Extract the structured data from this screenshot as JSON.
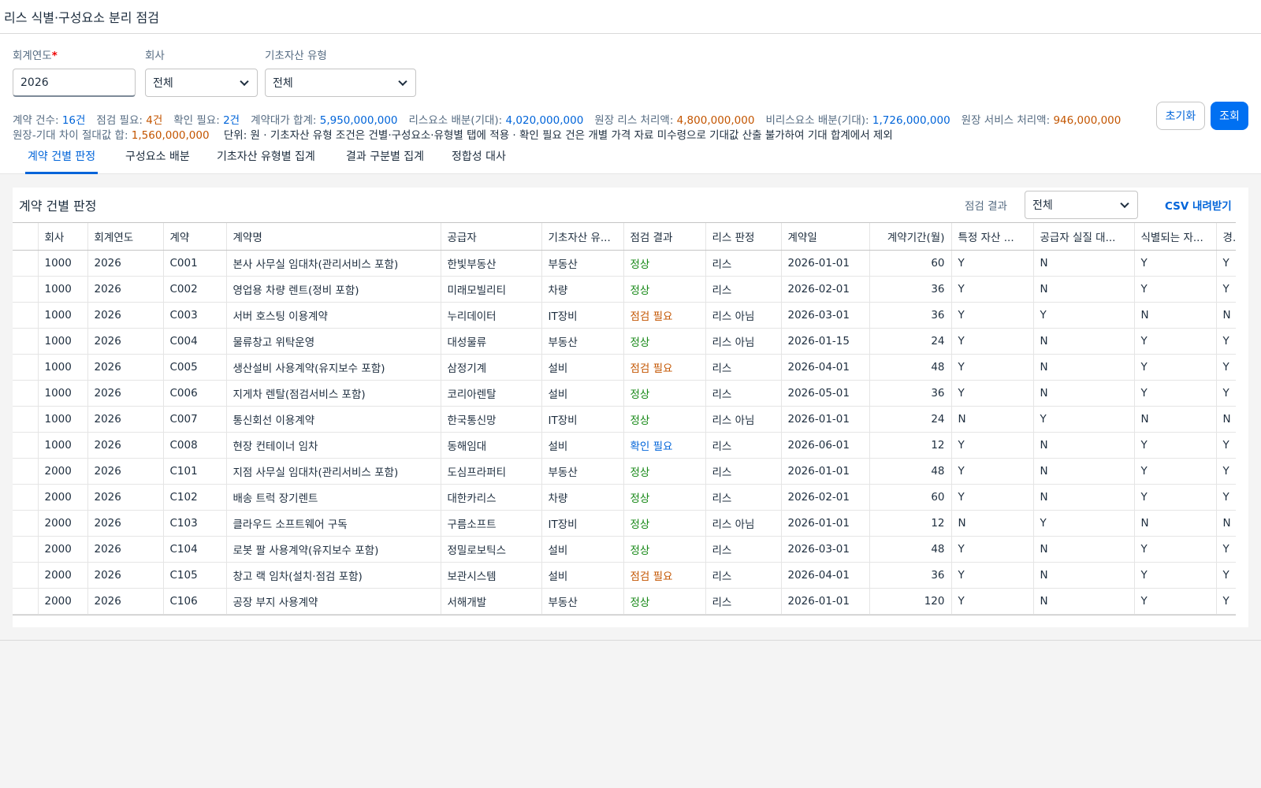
{
  "window": {
    "title": "리스 식별·구성요소 분리 점검"
  },
  "filters": {
    "year": {
      "label": "회계연도",
      "required_mark": "*",
      "value": "2026"
    },
    "company": {
      "label": "회사",
      "value": "전체"
    },
    "asset_type": {
      "label": "기초자산 유형",
      "value": "전체"
    }
  },
  "buttons": {
    "reset": "초기화",
    "search": "조회"
  },
  "summary": {
    "line1": [
      {
        "label": "계약 건수: ",
        "value": "16건",
        "tone": "blue"
      },
      {
        "label": "점검 필요: ",
        "value": "4건",
        "tone": "orange"
      },
      {
        "label": "확인 필요: ",
        "value": "2건",
        "tone": "blue"
      },
      {
        "label": "계약대가 합계: ",
        "value": "5,950,000,000",
        "tone": "blue"
      },
      {
        "label": "리스요소 배분(기대): ",
        "value": "4,020,000,000",
        "tone": "blue"
      },
      {
        "label": "원장 리스 처리액: ",
        "value": "4,800,000,000",
        "tone": "orange"
      },
      {
        "label": "비리스요소 배분(기대): ",
        "value": "1,726,000,000",
        "tone": "blue"
      },
      {
        "label": "원장 서비스 처리액: ",
        "value": "946,000,000",
        "tone": "orange"
      }
    ],
    "line2_label": "원장-기대 차이 절대값 합: ",
    "line2_value": "1,560,000,000",
    "note": "단위: 원 · 기초자산 유형 조건은 건별·구성요소·유형별 탭에 적용 · 확인 필요 건은 개별 가격 자료 미수령으로 기대값 산출 불가하여 기대 합계에서 제외"
  },
  "tabs": [
    {
      "label": "계약 건별 판정",
      "active": true
    },
    {
      "label": "구성요소 배분",
      "active": false
    },
    {
      "label": "기초자산 유형별 집계",
      "active": false
    },
    {
      "label": "결과 구분별 집계",
      "active": false
    },
    {
      "label": "정합성 대사",
      "active": false
    }
  ],
  "panel": {
    "title": "계약 건별 판정",
    "result_filter_label": "점검 결과",
    "result_filter_value": "전체",
    "csv_label": "CSV 내려받기"
  },
  "table": {
    "columns": [
      "회사",
      "회계연도",
      "계약",
      "계약명",
      "공급자",
      "기초자산 유...",
      "점검 결과",
      "리스 판정",
      "계약일",
      "계약기간(월)",
      "특정 자산 ...",
      "공급자 실질 대...",
      "식별되는 자...",
      "경"
    ],
    "rows": [
      [
        "1000",
        "2026",
        "C001",
        "본사 사무실 임대차(관리서비스 포함)",
        "한빛부동산",
        "부동산",
        "정상",
        "리스",
        "2026-01-01",
        "60",
        "Y",
        "N",
        "Y",
        "Y"
      ],
      [
        "1000",
        "2026",
        "C002",
        "영업용 차량 렌트(정비 포함)",
        "미래모빌리티",
        "차량",
        "정상",
        "리스",
        "2026-02-01",
        "36",
        "Y",
        "N",
        "Y",
        "Y"
      ],
      [
        "1000",
        "2026",
        "C003",
        "서버 호스팅 이용계약",
        "누리데이터",
        "IT장비",
        "점검 필요",
        "리스 아님",
        "2026-03-01",
        "36",
        "Y",
        "Y",
        "N",
        "N"
      ],
      [
        "1000",
        "2026",
        "C004",
        "물류창고 위탁운영",
        "대성물류",
        "부동산",
        "정상",
        "리스 아님",
        "2026-01-15",
        "24",
        "Y",
        "N",
        "Y",
        "Y"
      ],
      [
        "1000",
        "2026",
        "C005",
        "생산설비 사용계약(유지보수 포함)",
        "삼정기계",
        "설비",
        "점검 필요",
        "리스",
        "2026-04-01",
        "48",
        "Y",
        "N",
        "Y",
        "Y"
      ],
      [
        "1000",
        "2026",
        "C006",
        "지게차 렌탈(점검서비스 포함)",
        "코리아렌탈",
        "설비",
        "정상",
        "리스",
        "2026-05-01",
        "36",
        "Y",
        "N",
        "Y",
        "Y"
      ],
      [
        "1000",
        "2026",
        "C007",
        "통신회선 이용계약",
        "한국통신망",
        "IT장비",
        "정상",
        "리스 아님",
        "2026-01-01",
        "24",
        "N",
        "Y",
        "N",
        "N"
      ],
      [
        "1000",
        "2026",
        "C008",
        "현장 컨테이너 임차",
        "동해임대",
        "설비",
        "확인 필요",
        "리스",
        "2026-06-01",
        "12",
        "Y",
        "N",
        "Y",
        "Y"
      ],
      [
        "2000",
        "2026",
        "C101",
        "지점 사무실 임대차(관리서비스 포함)",
        "도심프라퍼티",
        "부동산",
        "정상",
        "리스",
        "2026-01-01",
        "48",
        "Y",
        "N",
        "Y",
        "Y"
      ],
      [
        "2000",
        "2026",
        "C102",
        "배송 트럭 장기렌트",
        "대한카리스",
        "차량",
        "정상",
        "리스",
        "2026-02-01",
        "60",
        "Y",
        "N",
        "Y",
        "Y"
      ],
      [
        "2000",
        "2026",
        "C103",
        "클라우드 소프트웨어 구독",
        "구름소프트",
        "IT장비",
        "정상",
        "리스 아님",
        "2026-01-01",
        "12",
        "N",
        "Y",
        "N",
        "N"
      ],
      [
        "2000",
        "2026",
        "C104",
        "로봇 팔 사용계약(유지보수 포함)",
        "정밀로보틱스",
        "설비",
        "정상",
        "리스",
        "2026-03-01",
        "48",
        "Y",
        "N",
        "Y",
        "Y"
      ],
      [
        "2000",
        "2026",
        "C105",
        "창고 랙 임차(설치·점검 포함)",
        "보관시스템",
        "설비",
        "점검 필요",
        "리스",
        "2026-04-01",
        "36",
        "Y",
        "N",
        "Y",
        "Y"
      ],
      [
        "2000",
        "2026",
        "C106",
        "공장 부지 사용계약",
        "서해개발",
        "부동산",
        "정상",
        "리스",
        "2026-01-01",
        "120",
        "Y",
        "N",
        "Y",
        "Y"
      ]
    ]
  }
}
